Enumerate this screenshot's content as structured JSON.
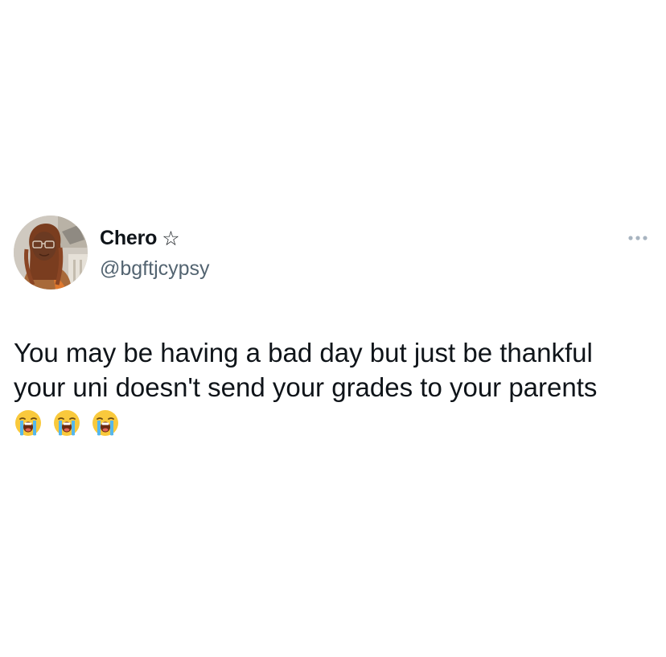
{
  "tweet": {
    "author": {
      "display_name": "Chero",
      "badge_icon": "star-outline-icon",
      "badge_glyph": "☆",
      "handle": "@bgftjcypsy",
      "avatar_icon": "profile-photo-avatar"
    },
    "more_icon": "more-options-icon",
    "text_lines": [
      "You may be having a bad day but just be thankful",
      "your uni doesn't send your grades to your parents"
    ],
    "emojis": [
      "loudly-crying-face-icon",
      "loudly-crying-face-icon",
      "loudly-crying-face-icon"
    ]
  },
  "colors": {
    "text_primary": "#0f1419",
    "text_secondary": "#536471",
    "more_dots": "#a8b4c0",
    "background": "#ffffff",
    "emoji_face": "#f9c93c",
    "emoji_tears": "#56b7ec"
  }
}
